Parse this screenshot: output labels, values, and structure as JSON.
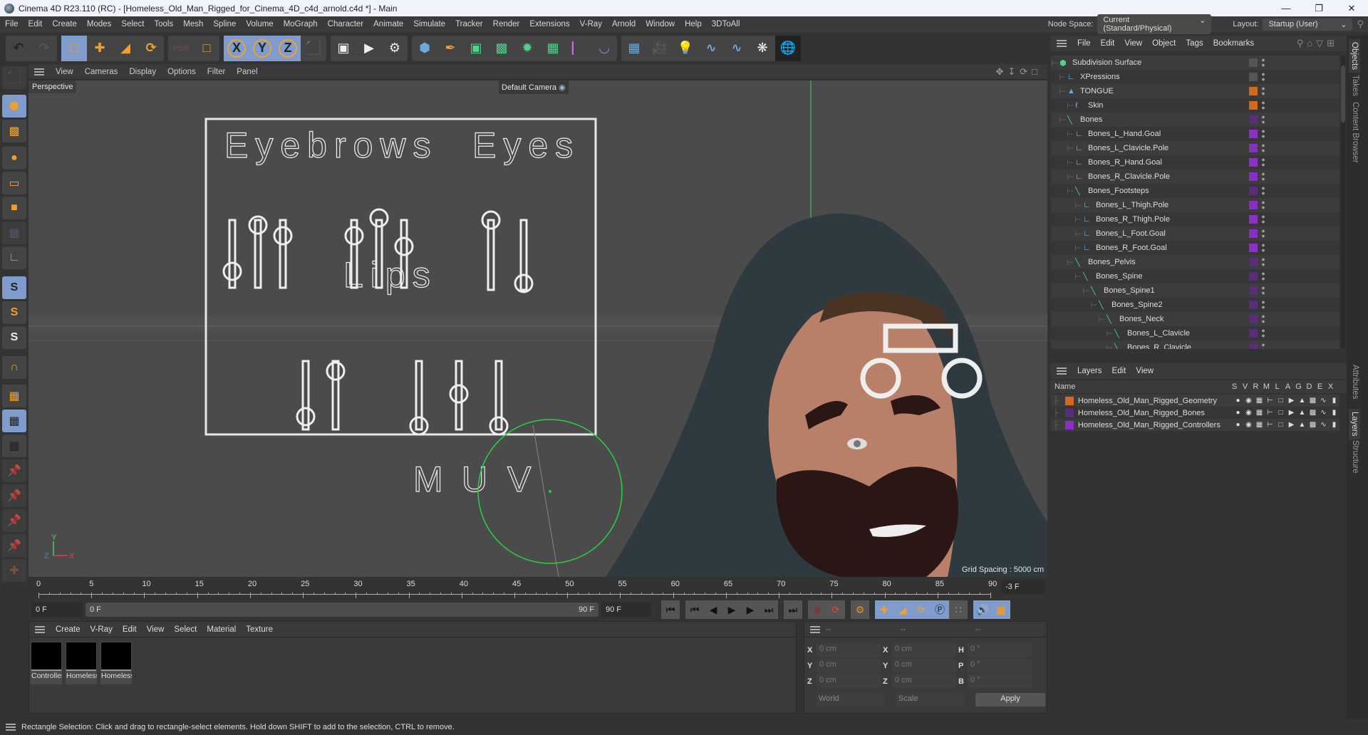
{
  "window": {
    "title": "Cinema 4D R23.110 (RC) - [Homeless_Old_Man_Rigged_for_Cinema_4D_c4d_arnold.c4d *] - Main",
    "controls": [
      "minimize",
      "maximize",
      "close"
    ]
  },
  "menubar": {
    "items": [
      "File",
      "Edit",
      "Create",
      "Modes",
      "Select",
      "Tools",
      "Mesh",
      "Spline",
      "Volume",
      "MoGraph",
      "Character",
      "Animate",
      "Simulate",
      "Tracker",
      "Render",
      "Extensions",
      "V-Ray",
      "Arnold",
      "Window",
      "Help",
      "3DToAll"
    ],
    "node_space_label": "Node Space:",
    "node_space_value": "Current (Standard/Physical)",
    "layout_label": "Layout:",
    "layout_value": "Startup (User)"
  },
  "toolbar": {
    "groups": [
      [
        "undo-icon",
        "redo-icon"
      ],
      [
        "live-selection-icon",
        "move-icon",
        "scale-icon",
        "rotate-icon"
      ],
      [
        "psr-icon",
        "selection-box-icon"
      ],
      [
        "x-axis-icon",
        "y-axis-icon",
        "z-axis-icon",
        "world-coordinates-icon"
      ],
      [
        "render-view-icon",
        "render-picture-viewer-icon",
        "render-settings-icon"
      ],
      [
        "cube-icon",
        "pen-icon",
        "subdivision-icon",
        "extrude-icon",
        "mograph-cloner-icon",
        "array-icon",
        "symmetry-icon",
        "deformer-icon"
      ],
      [
        "floor-icon",
        "camera-icon",
        "light-icon",
        "python-icon",
        "python-icon-2",
        "gear-icon",
        "sphere-wireframe-icon"
      ]
    ],
    "axis_labels": [
      "X",
      "Y",
      "Z"
    ]
  },
  "left_toolbar": {
    "items": [
      "make-editable-icon",
      "model-mode-icon",
      "texture-mode-icon",
      "points-mode-icon",
      "edges-mode-icon",
      "polygons-mode-icon",
      "uv-mode-icon",
      "axis-mode-icon",
      "snap-icon",
      "snap-settings-icon",
      "snap-3d-icon",
      "magnet-icon",
      "workplane-icon",
      "locked-workplane-icon",
      "workplane-rotate-icon",
      "pin-icon",
      "pin-p-icon",
      "pin-r-icon",
      "pin-target-icon",
      "paint-add-icon"
    ],
    "snap_letter": "S"
  },
  "viewport": {
    "menu": [
      "View",
      "Cameras",
      "Display",
      "Options",
      "Filter",
      "Panel"
    ],
    "view_name": "Perspective",
    "camera": "Default Camera",
    "grid_spacing": "Grid Spacing : 5000 cm",
    "axis": {
      "x": "X",
      "y": "Y",
      "z": "Z"
    },
    "face_panel": {
      "labels": [
        "Eyebrows",
        "Eyes",
        "Lips",
        "M",
        "U",
        "V"
      ]
    }
  },
  "timeline": {
    "ticks": [
      0,
      5,
      10,
      15,
      20,
      25,
      30,
      35,
      40,
      45,
      50,
      55,
      60,
      65,
      70,
      75,
      80,
      85,
      90
    ],
    "current_frame": "-3 F",
    "start_field": "0 F",
    "range_start": "0 F",
    "range_end": "90 F",
    "end_field": "90 F"
  },
  "playback": {
    "buttons": [
      "go-to-start-icon",
      "previous-key-icon",
      "previous-frame-icon",
      "play-icon",
      "next-frame-icon",
      "next-key-icon",
      "go-to-end-icon",
      "record-off-icon",
      "autokey-icon",
      "keyframe-selection-icon",
      "key-position-icon",
      "key-scale-icon",
      "key-rotation-icon",
      "key-param-icon",
      "key-pla-icon",
      "sound-icon",
      "timeline-icon"
    ]
  },
  "material_manager": {
    "menu": [
      "Create",
      "V-Ray",
      "Edit",
      "View",
      "Select",
      "Material",
      "Texture"
    ],
    "materials": [
      "Controllers",
      "Homeless",
      "Homeless"
    ]
  },
  "coordinates": {
    "headers": [
      "--",
      "--",
      "--"
    ],
    "rows": [
      {
        "l1": "X",
        "v1": "0 cm",
        "l2": "X",
        "v2": "0 cm",
        "l3": "H",
        "v3": "0 °"
      },
      {
        "l1": "Y",
        "v1": "0 cm",
        "l2": "Y",
        "v2": "0 cm",
        "l3": "P",
        "v3": "0 °"
      },
      {
        "l1": "Z",
        "v1": "0 cm",
        "l2": "Z",
        "v2": "0 cm",
        "l3": "B",
        "v3": "0 °"
      }
    ],
    "mode": "World",
    "transform": "Scale",
    "apply_label": "Apply"
  },
  "status_bar": "Rectangle Selection: Click and drag to rectangle-select elements. Hold down SHIFT to add to the selection, CTRL to remove.",
  "object_manager": {
    "menu": [
      "File",
      "Edit",
      "View",
      "Object",
      "Tags",
      "Bookmarks"
    ],
    "objects": [
      {
        "name": "Subdivision Surface",
        "depth": 0,
        "icon": "subdivision-icon",
        "color": "#555555"
      },
      {
        "name": "XPressions",
        "depth": 1,
        "icon": "null-icon",
        "color": "#555555"
      },
      {
        "name": "TONGUE",
        "depth": 1,
        "icon": "polygon-icon",
        "color": "#d2691e"
      },
      {
        "name": "Skin",
        "depth": 2,
        "icon": "skin-icon",
        "color": "#d2691e"
      },
      {
        "name": "Bones",
        "depth": 1,
        "icon": "bone-icon",
        "color": "#5a2d7a"
      },
      {
        "name": "Bones_L_Hand.Goal",
        "depth": 2,
        "icon": "null-icon",
        "color": "#8b2fc9"
      },
      {
        "name": "Bones_L_Clavicle.Pole",
        "depth": 2,
        "icon": "null-icon",
        "color": "#8b2fc9"
      },
      {
        "name": "Bones_R_Hand.Goal",
        "depth": 2,
        "icon": "null-icon",
        "color": "#8b2fc9"
      },
      {
        "name": "Bones_R_Clavicle.Pole",
        "depth": 2,
        "icon": "null-icon",
        "color": "#8b2fc9"
      },
      {
        "name": "Bones_Footsteps",
        "depth": 2,
        "icon": "bone-icon",
        "color": "#5a2d7a"
      },
      {
        "name": "Bones_L_Thigh.Pole",
        "depth": 3,
        "icon": "null-icon",
        "color": "#8b2fc9"
      },
      {
        "name": "Bones_R_Thigh.Pole",
        "depth": 3,
        "icon": "null-icon",
        "color": "#8b2fc9"
      },
      {
        "name": "Bones_L_Foot.Goal",
        "depth": 3,
        "icon": "null-icon",
        "color": "#8b2fc9"
      },
      {
        "name": "Bones_R_Foot.Goal",
        "depth": 3,
        "icon": "null-icon",
        "color": "#8b2fc9"
      },
      {
        "name": "Bones_Pelvis",
        "depth": 2,
        "icon": "bone-icon",
        "color": "#5a2d7a"
      },
      {
        "name": "Bones_Spine",
        "depth": 3,
        "icon": "bone-icon",
        "color": "#5a2d7a"
      },
      {
        "name": "Bones_Spine1",
        "depth": 4,
        "icon": "bone-icon",
        "color": "#5a2d7a"
      },
      {
        "name": "Bones_Spine2",
        "depth": 5,
        "icon": "bone-icon",
        "color": "#5a2d7a"
      },
      {
        "name": "Bones_Neck",
        "depth": 6,
        "icon": "bone-icon",
        "color": "#5a2d7a"
      },
      {
        "name": "Bones_L_Clavicle",
        "depth": 7,
        "icon": "bone-icon",
        "color": "#5a2d7a"
      },
      {
        "name": "Bones_R_Clavicle",
        "depth": 7,
        "icon": "bone-icon",
        "color": "#5a2d7a"
      }
    ]
  },
  "layer_manager": {
    "menu": [
      "Layers",
      "Edit",
      "View"
    ],
    "columns": [
      "Name",
      "S",
      "V",
      "R",
      "M",
      "L",
      "A",
      "G",
      "D",
      "E",
      "X"
    ],
    "layers": [
      {
        "name": "Homeless_Old_Man_Rigged_Geometry",
        "color": "#d2691e"
      },
      {
        "name": "Homeless_Old_Man_Rigged_Bones",
        "color": "#5a2d7a"
      },
      {
        "name": "Homeless_Old_Man_Rigged_Controllers",
        "color": "#8b2fc9"
      }
    ]
  },
  "side_tabs": {
    "top": [
      "Objects",
      "Takes",
      "Content Browser"
    ],
    "bottom": [
      "Attributes",
      "Layers",
      "Structure"
    ]
  }
}
